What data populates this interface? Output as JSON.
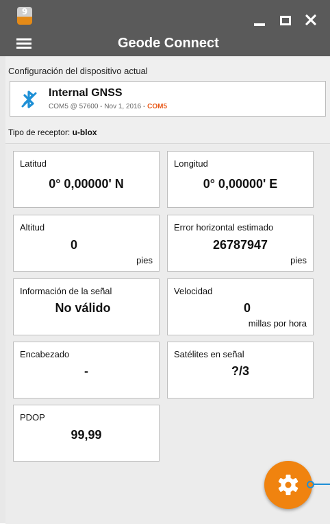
{
  "app": {
    "title": "Geode Connect",
    "icon_digit": "9",
    "icon": "geode-app-icon"
  },
  "window": {
    "menu_icon": "hamburger-icon",
    "minimize_icon": "minimize-icon",
    "maximize_icon": "maximize-icon",
    "close_icon": "close-icon"
  },
  "device": {
    "section_label": "Configuración del dispositivo actual",
    "icon": "bluetooth-disconnected-icon",
    "name": "Internal GNSS",
    "details": "COM5 @ 57600 - Nov 1, 2016 - ",
    "port": "COM5",
    "receiver_label": "Tipo de receptor: ",
    "receiver_value": "u-blox"
  },
  "cards": [
    {
      "label": "Latitud",
      "value": "0° 0,00000' N",
      "unit": ""
    },
    {
      "label": "Longitud",
      "value": "0° 0,00000' E",
      "unit": ""
    },
    {
      "label": "Altitud",
      "value": "0",
      "unit": "pies"
    },
    {
      "label": "Error horizontal estimado",
      "value": "26787947",
      "unit": "pies"
    },
    {
      "label": "Información de la señal",
      "value": "No válido",
      "unit": ""
    },
    {
      "label": "Velocidad",
      "value": "0",
      "unit": "millas por hora"
    },
    {
      "label": "Encabezado",
      "value": "-",
      "unit": ""
    },
    {
      "label": "Satélites en señal",
      "value": "?/3",
      "unit": ""
    },
    {
      "label": "PDOP",
      "value": "99,99",
      "unit": ""
    }
  ],
  "fab": {
    "icon": "gear-icon"
  },
  "colors": {
    "titlebar": "#5a5a5a",
    "accent": "#f0830f",
    "port_highlight": "#e85a1a",
    "bluetooth": "#1e90d6"
  }
}
